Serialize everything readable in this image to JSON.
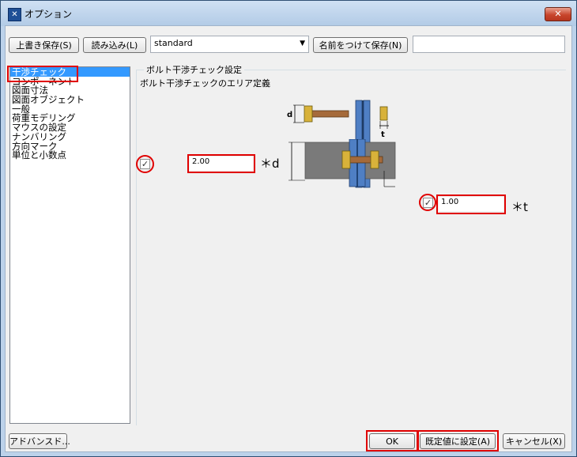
{
  "window": {
    "title": "オプション",
    "close_label": "✕",
    "app_icon": "app-icon"
  },
  "toolbar": {
    "overwrite_save": "上書き保存(S)",
    "load": "読み込み(L)",
    "preset_value": "standard",
    "save_as": "名前をつけて保存(N)",
    "save_name_value": ""
  },
  "tree": {
    "items": [
      "干渉チェック",
      "コンポーネント",
      "図面寸法",
      "図面オブジェクト",
      "一般",
      "荷重モデリング",
      "マウスの設定",
      "ナンバリング",
      "方向マーク",
      "単位と小数点"
    ],
    "selected_index": 0
  },
  "panel": {
    "group_title": "ボルト干渉チェック設定",
    "area_label": "ボルト干渉チェックのエリア定義",
    "d_check": {
      "checked": true,
      "value": "2.00",
      "suffix": "＊d"
    },
    "t_check": {
      "checked": true,
      "value": "1.00",
      "suffix": "＊t"
    },
    "diagram": {
      "label_d": "d",
      "label_t": "t"
    }
  },
  "footer": {
    "advanced": "アドバンスド...",
    "ok": "OK",
    "set_default": "既定値に設定(A)",
    "cancel": "キャンセル(X)"
  },
  "colors": {
    "highlight_red": "#e00000",
    "selection_blue": "#3399ff",
    "plate_blue": "#3d6fb6",
    "bolt_gold": "#d8b23a"
  }
}
